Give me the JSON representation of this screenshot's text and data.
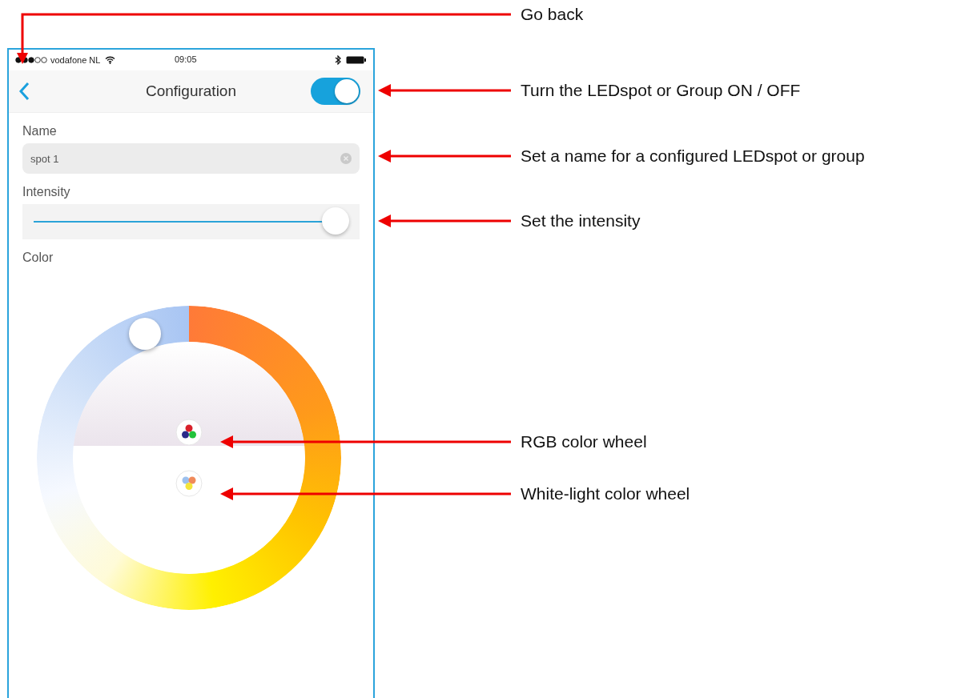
{
  "status_bar": {
    "carrier": "vodafone NL",
    "time": "09:05"
  },
  "nav": {
    "title": "Configuration",
    "power_on": true
  },
  "name_field": {
    "label": "Name",
    "value": "spot 1"
  },
  "intensity": {
    "label": "Intensity",
    "level": 0.96
  },
  "color": {
    "label": "Color",
    "modes": [
      {
        "kind": "rgb",
        "selected": true
      },
      {
        "kind": "white",
        "selected": false
      }
    ]
  },
  "annotations": [
    {
      "kind": "back",
      "text": "Go back"
    },
    {
      "kind": "toggle",
      "text": "Turn the LEDspot or Group ON / OFF"
    },
    {
      "kind": "name",
      "text": "Set a name for a configured LEDspot or group"
    },
    {
      "kind": "intensity",
      "text": "Set the intensity"
    },
    {
      "kind": "rgb",
      "text": "RGB color wheel"
    },
    {
      "kind": "white",
      "text": "White-light color wheel"
    }
  ]
}
